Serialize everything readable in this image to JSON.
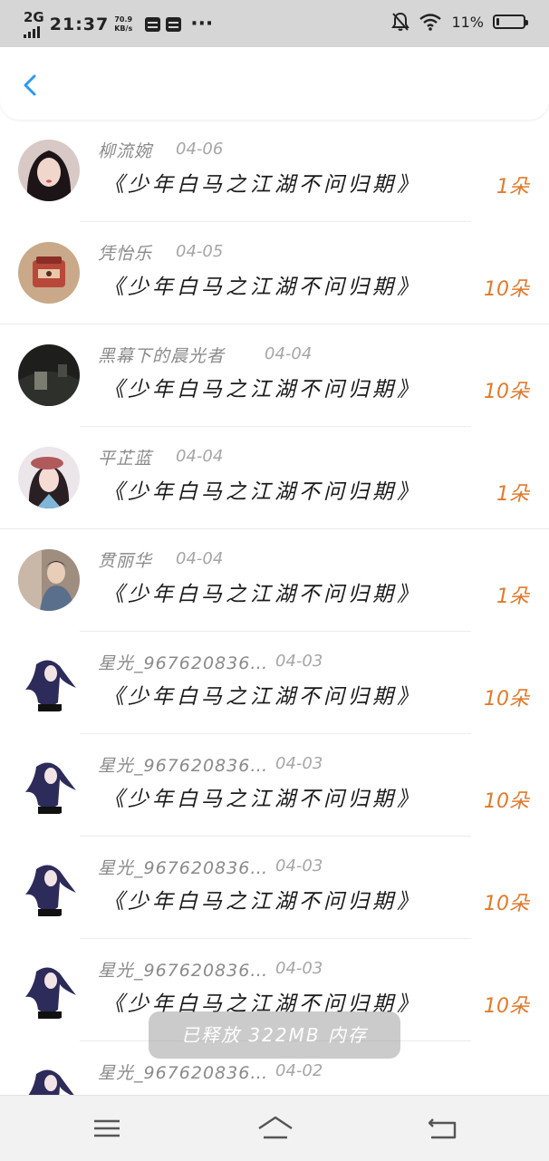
{
  "status_bar": {
    "network": "2G",
    "time": "21:37",
    "speed_value": "70.9",
    "speed_unit": "KB/s",
    "more": "···",
    "battery_pct": "11%",
    "battery_level": 0.11
  },
  "header": {
    "back_icon": "chevron-left-icon",
    "accent_color": "#2b9af3"
  },
  "records": [
    {
      "user": "柳流婉",
      "date": "04-06",
      "title": "《少年白马之江湖不问归期》",
      "count": "1朵"
    },
    {
      "user": "凭怡乐",
      "date": "04-05",
      "title": "《少年白马之江湖不问归期》",
      "count": "10朵"
    },
    {
      "user": "黑幕下的晨光者",
      "date": "04-04",
      "title": "《少年白马之江湖不问归期》",
      "count": "10朵"
    },
    {
      "user": "平芷蓝",
      "date": "04-04",
      "title": "《少年白马之江湖不问归期》",
      "count": "1朵"
    },
    {
      "user": "贯丽华",
      "date": "04-04",
      "title": "《少年白马之江湖不问归期》",
      "count": "1朵"
    },
    {
      "user": "星光_967620836…",
      "date": "04-03",
      "title": "《少年白马之江湖不问归期》",
      "count": "10朵"
    },
    {
      "user": "星光_967620836…",
      "date": "04-03",
      "title": "《少年白马之江湖不问归期》",
      "count": "10朵"
    },
    {
      "user": "星光_967620836…",
      "date": "04-03",
      "title": "《少年白马之江湖不问归期》",
      "count": "10朵"
    },
    {
      "user": "星光_967620836…",
      "date": "04-03",
      "title": "《少年白马之江湖不问归期》",
      "count": "10朵"
    },
    {
      "user": "星光_967620836…",
      "date": "04-02",
      "title": "",
      "count": ""
    }
  ],
  "toast": {
    "text": "已释放 322MB 内存"
  },
  "nav_bar": {
    "menu_icon": "menu-icon",
    "home_icon": "home-icon",
    "back_icon": "back-icon"
  },
  "colors": {
    "count": "#e07a2c",
    "username": "#8a8a8a",
    "date": "#a6a6a6",
    "title": "#1a1a1a"
  }
}
